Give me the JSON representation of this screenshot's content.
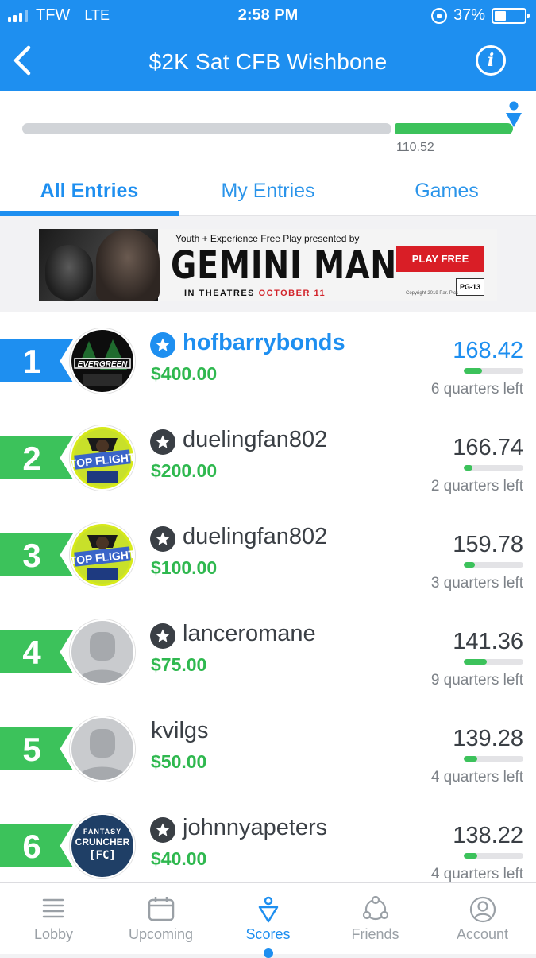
{
  "status_bar": {
    "carrier": "TFW",
    "network": "LTE",
    "time": "2:58 PM",
    "battery": "37%"
  },
  "header": {
    "title": "$2K Sat CFB Wishbone"
  },
  "progress": {
    "value_label": "110.52",
    "fraction": 0.24
  },
  "tabs": [
    {
      "label": "All Entries",
      "active": true
    },
    {
      "label": "My Entries",
      "active": false
    },
    {
      "label": "Games",
      "active": false
    }
  ],
  "ad": {
    "subtitle": "Youth + Experience Free Play presented by",
    "title": "GEMINI MAN",
    "date_prefix": "IN THEATRES",
    "date": "OCTOBER 11",
    "cta": "PLAY FREE",
    "rating": "PG-13",
    "copyright": "Copyright 2019 Par. Pics"
  },
  "entries": [
    {
      "rank": "1",
      "name": "hofbarrybonds",
      "prize": "$400.00",
      "score": "168.42",
      "remaining": "6 quarters left",
      "progress": 0.3,
      "is_me": true,
      "starred": true,
      "flag_color": "#1e8ff0",
      "avatar": "evergreen-logo"
    },
    {
      "rank": "2",
      "name": "duelingfan802",
      "prize": "$200.00",
      "score": "166.74",
      "remaining": "2 quarters left",
      "progress": 0.15,
      "is_me": false,
      "starred": true,
      "flag_color": "#3cc25b",
      "avatar": "top-flight-logo"
    },
    {
      "rank": "3",
      "name": "duelingfan802",
      "prize": "$100.00",
      "score": "159.78",
      "remaining": "3 quarters left",
      "progress": 0.18,
      "is_me": false,
      "starred": true,
      "flag_color": "#3cc25b",
      "avatar": "top-flight-logo"
    },
    {
      "rank": "4",
      "name": "lanceromane",
      "prize": "$75.00",
      "score": "141.36",
      "remaining": "9 quarters left",
      "progress": 0.38,
      "is_me": false,
      "starred": true,
      "flag_color": "#3cc25b",
      "avatar": "default-avatar"
    },
    {
      "rank": "5",
      "name": "kvilgs",
      "prize": "$50.00",
      "score": "139.28",
      "remaining": "4 quarters left",
      "progress": 0.22,
      "is_me": false,
      "starred": false,
      "flag_color": "#3cc25b",
      "avatar": "default-avatar"
    },
    {
      "rank": "6",
      "name": "johnnyapeters",
      "prize": "$40.00",
      "score": "138.22",
      "remaining": "4 quarters left",
      "progress": 0.22,
      "is_me": false,
      "starred": true,
      "flag_color": "#3cc25b",
      "avatar": "fantasy-cruncher-logo",
      "avatar_text": [
        "FANTASY",
        "CRUNCHER",
        "[FC]"
      ]
    }
  ],
  "bottom_nav": [
    {
      "label": "Lobby",
      "icon": "list-icon",
      "active": false
    },
    {
      "label": "Upcoming",
      "icon": "calendar-icon",
      "active": false
    },
    {
      "label": "Scores",
      "icon": "scores-icon",
      "active": true
    },
    {
      "label": "Friends",
      "icon": "friends-icon",
      "active": false
    },
    {
      "label": "Account",
      "icon": "account-icon",
      "active": false
    }
  ],
  "colors": {
    "brand_blue": "#1e8ff0",
    "green": "#3cc25b",
    "prize_green": "#2fb84f"
  }
}
